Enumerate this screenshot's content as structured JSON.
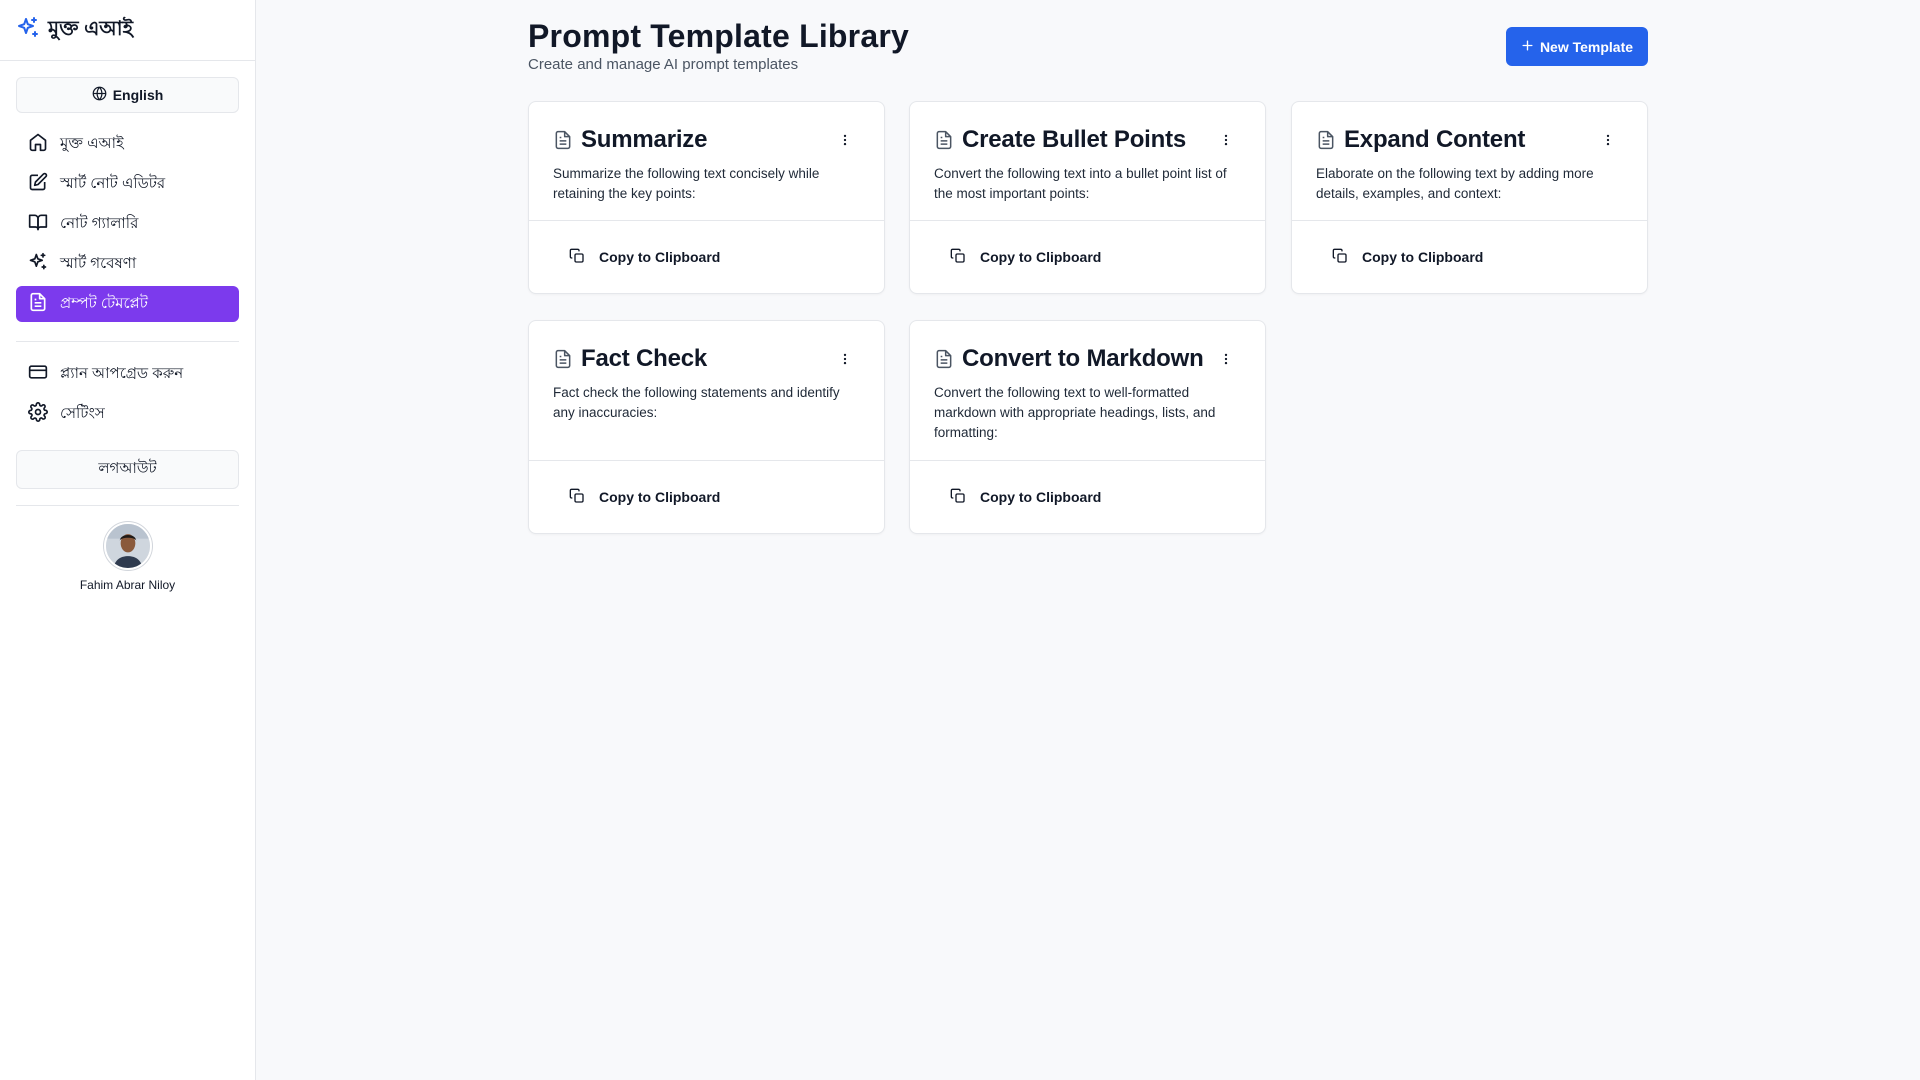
{
  "brand": {
    "name": "মুক্ত এআই",
    "icon": "sparkles-icon",
    "accent": "#2563eb"
  },
  "sidebar": {
    "language_button": "English",
    "nav": [
      {
        "label": "মুক্ত এআই",
        "icon": "home-icon"
      },
      {
        "label": "স্মার্ট নোট এডিটর",
        "icon": "edit-icon"
      },
      {
        "label": "নোট গ্যালারি",
        "icon": "book-icon"
      },
      {
        "label": "স্মার্ট গবেষণা",
        "icon": "sparkles-icon"
      },
      {
        "label": "প্রম্পট টেমপ্লেট",
        "icon": "file-text-icon",
        "active": true
      }
    ],
    "nav_secondary": [
      {
        "label": "প্ল্যান আপগ্রেড করুন",
        "icon": "credit-card-icon"
      },
      {
        "label": "সেটিংস",
        "icon": "settings-icon"
      }
    ],
    "logout": "লগআউট",
    "user": {
      "name": "Fahim Abrar Niloy"
    },
    "active_color": "#7c3aed"
  },
  "main": {
    "title": "Prompt Template Library",
    "subtitle": "Create and manage AI prompt templates",
    "new_button": "New Template",
    "cards": [
      {
        "title": "Summarize",
        "description": "Summarize the following text concisely while retaining the key points:",
        "action": "Copy to Clipboard"
      },
      {
        "title": "Create Bullet Points",
        "description": "Convert the following text into a bullet point list of the most important points:",
        "action": "Copy to Clipboard"
      },
      {
        "title": "Expand Content",
        "description": "Elaborate on the following text by adding more details, examples, and context:",
        "action": "Copy to Clipboard"
      },
      {
        "title": "Fact Check",
        "description": "Fact check the following statements and identify any inaccuracies:",
        "action": "Copy to Clipboard"
      },
      {
        "title": "Convert to Markdown",
        "description": "Convert the following text to well-formatted markdown with appropriate headings, lists, and formatting:",
        "action": "Copy to Clipboard"
      }
    ]
  }
}
